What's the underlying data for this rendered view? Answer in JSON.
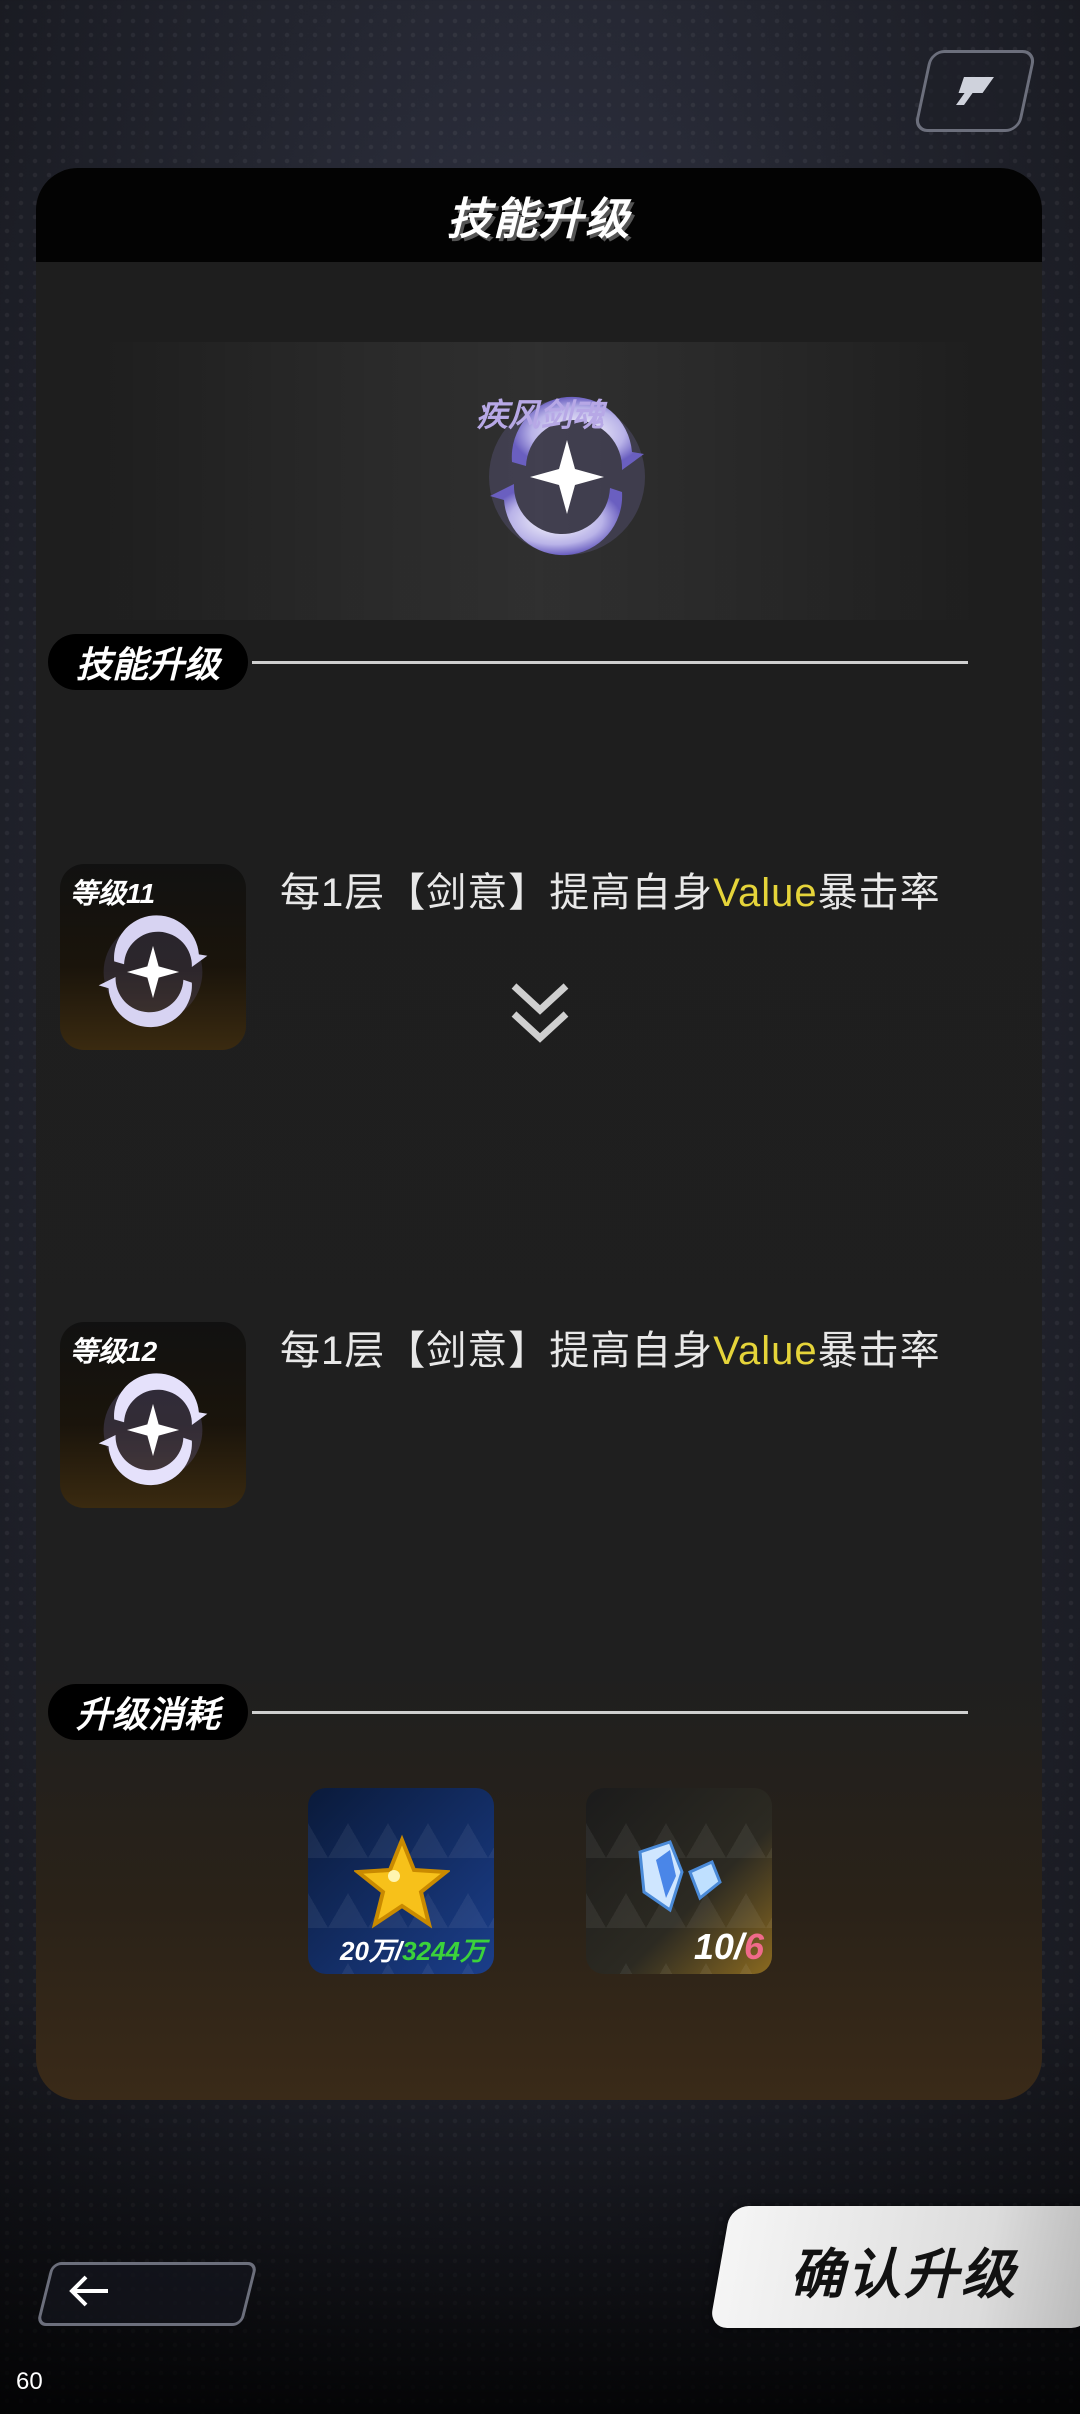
{
  "header": {
    "title": "技能升级"
  },
  "skill": {
    "name": "疾风剑魂"
  },
  "sections": {
    "upgrade_title": "技能升级",
    "cost_title": "升级消耗"
  },
  "current": {
    "level_label": "等级11",
    "desc_before": "每1层【剑意】提高自身",
    "desc_highlight": "Value",
    "desc_after": "暴击率"
  },
  "next": {
    "level_label": "等级12",
    "desc_before": "每1层【剑意】提高自身",
    "desc_highlight": "Value",
    "desc_after": "暴击率"
  },
  "costs": [
    {
      "icon": "gold-star-icon",
      "required": "20万",
      "separator": "/",
      "owned": "3244万",
      "owned_color": "#3bd23b"
    },
    {
      "icon": "crystal-icon",
      "required": "10",
      "separator": "/",
      "owned": "6",
      "owned_color": "#f06a8a"
    }
  ],
  "buttons": {
    "confirm_label": "确认升级"
  },
  "debug": {
    "fps": "60"
  },
  "colors": {
    "highlight": "#e5d43a",
    "panel": "#1f1f1f",
    "header": "#030303"
  }
}
